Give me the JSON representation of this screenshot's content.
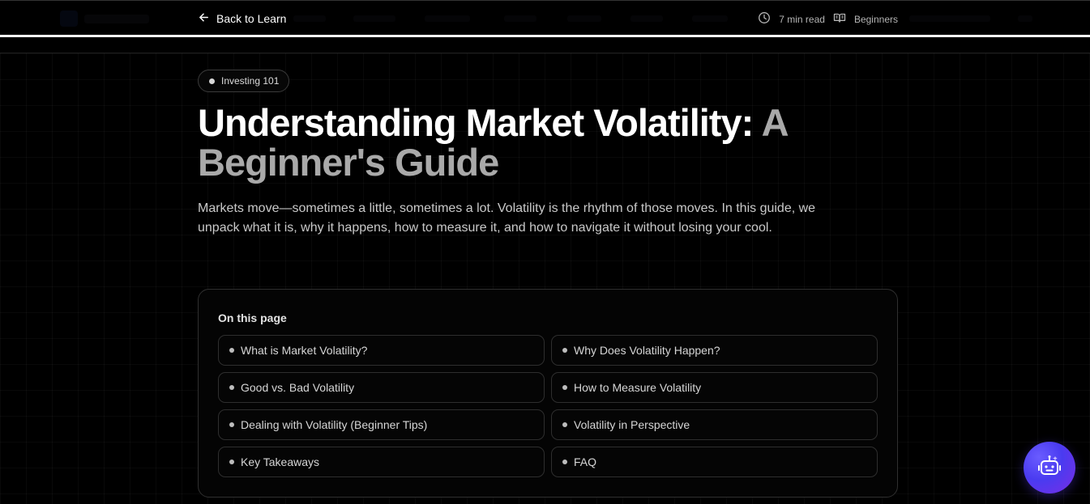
{
  "header": {
    "back_label": "Back to Learn",
    "read_time": "7 min read",
    "level": "Beginners"
  },
  "article": {
    "category": "Investing 101",
    "title_main": "Understanding Market Volatility:",
    "title_accent_1": "A",
    "title_accent_2": "Beginner's Guide",
    "intro": "Markets move—sometimes a little, sometimes a lot. Volatility is the rhythm of those moves. In this guide, we unpack what it is, why it happens, how to measure it, and how to navigate it without losing your cool."
  },
  "toc": {
    "title": "On this page",
    "items": [
      {
        "label": "What is Market Volatility?"
      },
      {
        "label": "Why Does Volatility Happen?"
      },
      {
        "label": "Good vs. Bad Volatility"
      },
      {
        "label": "How to Measure Volatility"
      },
      {
        "label": "Dealing with Volatility (Beginner Tips)"
      },
      {
        "label": "Volatility in Perspective"
      },
      {
        "label": "Key Takeaways"
      },
      {
        "label": "FAQ"
      }
    ]
  },
  "icons": {
    "back": "arrow-left-icon",
    "clock": "clock-icon",
    "book": "book-open-icon",
    "assistant": "robot-icon"
  },
  "colors": {
    "background": "#000000",
    "accent_gradient_start": "#4a3bf0",
    "accent_gradient_end": "#7a2de6",
    "title_muted": "#a9a9a9"
  }
}
